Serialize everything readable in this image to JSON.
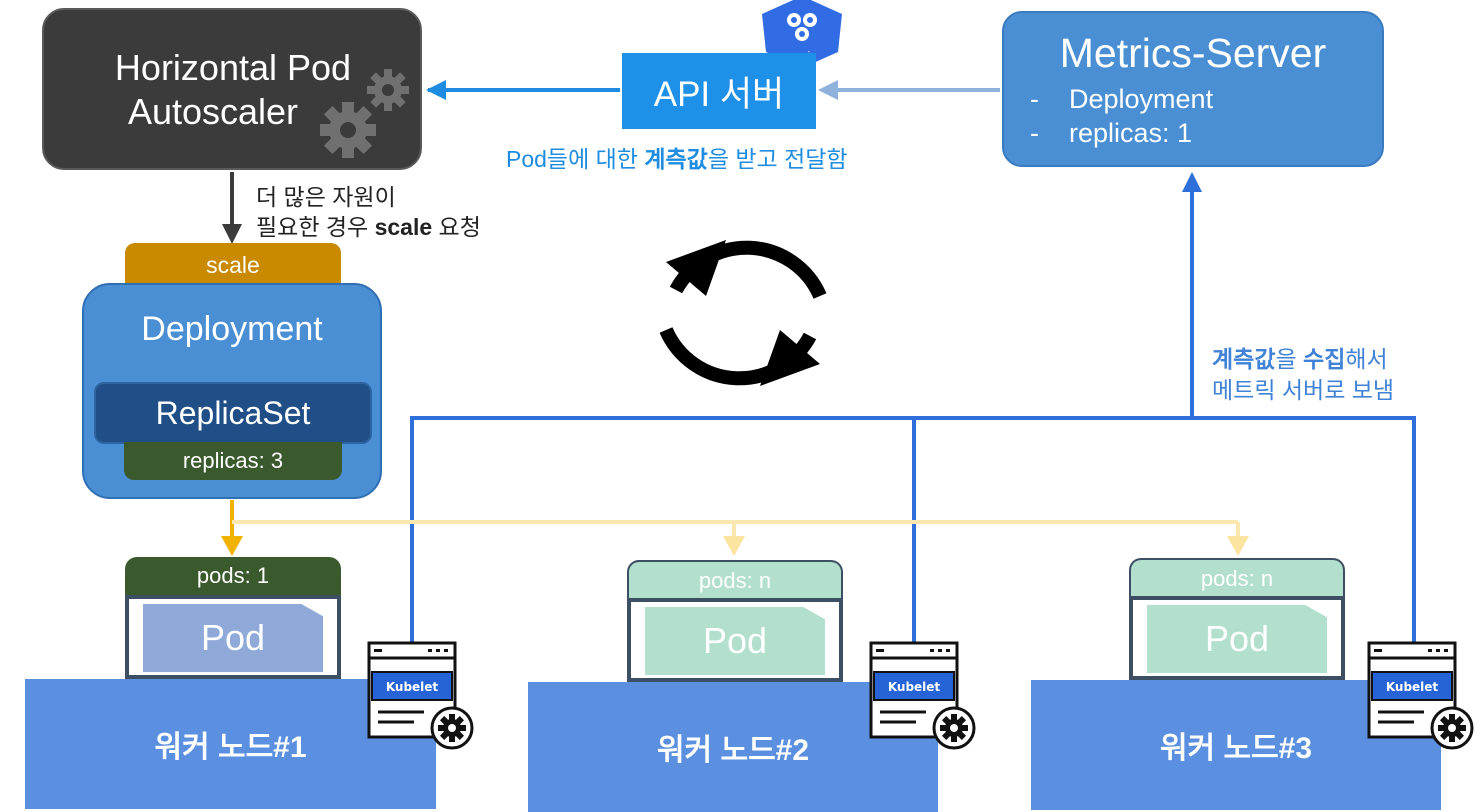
{
  "hpa": {
    "title_line1": "Horizontal Pod",
    "title_line2": "Autoscaler"
  },
  "api_server": {
    "label": "API 서버",
    "logo_text": "api",
    "caption_pre": "Pod들에 대한 ",
    "caption_bold": "계측값",
    "caption_post": "을 받고 전달함"
  },
  "metrics_server": {
    "title": "Metrics-Server",
    "bullets": [
      "Deployment",
      "replicas: 1"
    ]
  },
  "scale_request": {
    "line1": "더 많은 자원이",
    "line2_pre": "필요한 경우 ",
    "line2_bold": "scale",
    "line2_post": " 요청"
  },
  "deployment": {
    "scale_tab": "scale",
    "title": "Deployment",
    "replicaset": "ReplicaSet",
    "replicas": "replicas: 3"
  },
  "collect_note": {
    "l1_bold1": "계측값",
    "l1_mid": "을 ",
    "l1_bold2": "수집",
    "l1_post": "해서",
    "line2": "메트릭 서버로 보냄"
  },
  "kubelet_label": "Kubelet",
  "nodes": [
    {
      "name": "워커 노드#1",
      "pods": "pods: 1",
      "pod": "Pod"
    },
    {
      "name": "워커 노드#2",
      "pods": "pods: n",
      "pod": "Pod"
    },
    {
      "name": "워커 노드#3",
      "pods": "pods: n",
      "pod": "Pod"
    }
  ],
  "colors": {
    "hpa_bg": "#3b3b3b",
    "api_blue": "#1e90e8",
    "metrics_bg": "#4a8fd4",
    "node_bg": "#5b8fe0",
    "scale_gold": "#c98a00",
    "pod_active": "#8fa9d9",
    "pod_pending": "#b2e0cc",
    "kubelet_line": "#2f6fdc"
  }
}
